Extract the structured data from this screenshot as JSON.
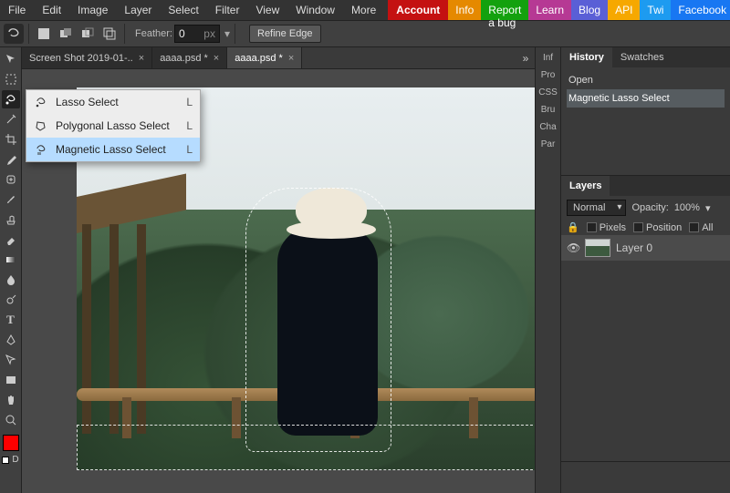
{
  "menu": {
    "items": [
      "File",
      "Edit",
      "Image",
      "Layer",
      "Select",
      "Filter",
      "View",
      "Window",
      "More"
    ],
    "account": "Account"
  },
  "topbtns": {
    "info": "Info",
    "bug": "Report a bug",
    "learn": "Learn",
    "blog": "Blog",
    "api": "API",
    "twi": "Twi",
    "fb": "Facebook"
  },
  "optbar": {
    "feather_label": "Feather:",
    "feather_value": "0",
    "feather_unit": "px",
    "refine": "Refine Edge"
  },
  "tabs": [
    {
      "label": "Screen Shot 2019-01-..",
      "active": false,
      "close": "×"
    },
    {
      "label": "aaaa.psd *",
      "active": false,
      "close": "×"
    },
    {
      "label": "aaaa.psd *",
      "active": true,
      "close": "×"
    }
  ],
  "sidecol": [
    "Inf",
    "Pro",
    "CSS",
    "Bru",
    "Cha",
    "Par"
  ],
  "history": {
    "tabs": [
      "History",
      "Swatches"
    ],
    "items": [
      "Open",
      "Magnetic Lasso Select"
    ]
  },
  "layers": {
    "tab": "Layers",
    "blend": "Normal",
    "opacity_label": "Opacity:",
    "opacity_value": "100%",
    "lock_label": "",
    "pixels": "Pixels",
    "position": "Position",
    "all": "All",
    "layer0": "Layer 0"
  },
  "lasso_popup": [
    {
      "icon": "lasso-icon",
      "label": "Lasso Select",
      "key": "L",
      "hl": false
    },
    {
      "icon": "poly-lasso-icon",
      "label": "Polygonal Lasso Select",
      "key": "L",
      "hl": false
    },
    {
      "icon": "magnetic-lasso-icon",
      "label": "Magnetic Lasso Select",
      "key": "L",
      "hl": true
    }
  ],
  "swatch": {
    "fg": "#ff0000",
    "mode": "D"
  },
  "toolbar_icons": [
    "move",
    "marquee",
    "lasso",
    "wand",
    "crop",
    "eyedropper",
    "heal",
    "brush",
    "clone",
    "eraser",
    "bucket",
    "gradient",
    "blur",
    "dodge",
    "pen",
    "text",
    "path",
    "shape",
    "hand",
    "zoom"
  ]
}
